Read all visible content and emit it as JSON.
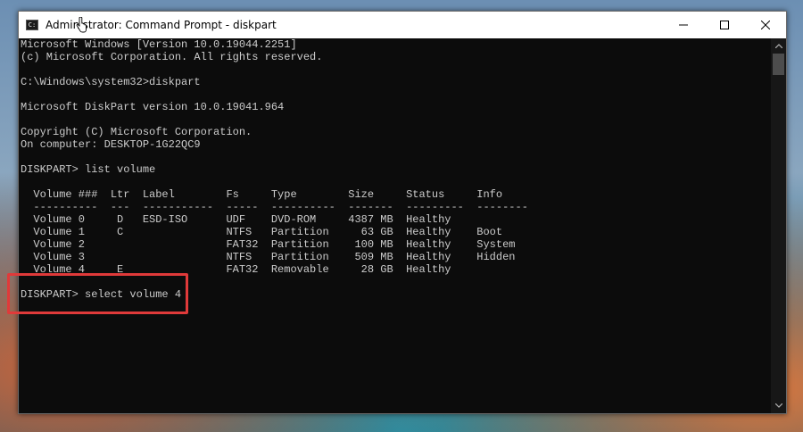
{
  "window": {
    "title": "Administrator: Command Prompt - diskpart",
    "icon": "cmd-icon"
  },
  "console_lines": [
    "Microsoft Windows [Version 10.0.19044.2251]",
    "(c) Microsoft Corporation. All rights reserved.",
    "",
    "C:\\Windows\\system32>diskpart",
    "",
    "Microsoft DiskPart version 10.0.19041.964",
    "",
    "Copyright (C) Microsoft Corporation.",
    "On computer: DESKTOP-1G22QC9",
    "",
    "DISKPART> list volume",
    "",
    "  Volume ###  Ltr  Label        Fs     Type        Size     Status     Info",
    "  ----------  ---  -----------  -----  ----------  -------  ---------  --------",
    "  Volume 0     D   ESD-ISO      UDF    DVD-ROM     4387 MB  Healthy",
    "  Volume 1     C                NTFS   Partition     63 GB  Healthy    Boot",
    "  Volume 2                      FAT32  Partition    100 MB  Healthy    System",
    "  Volume 3                      NTFS   Partition    509 MB  Healthy    Hidden",
    "  Volume 4     E                FAT32  Removable     28 GB  Healthy",
    "",
    "DISKPART> select volume 4"
  ],
  "colors": {
    "highlight": "#e03a3a",
    "console_text": "#cccccc",
    "console_bg": "#0c0c0c"
  }
}
